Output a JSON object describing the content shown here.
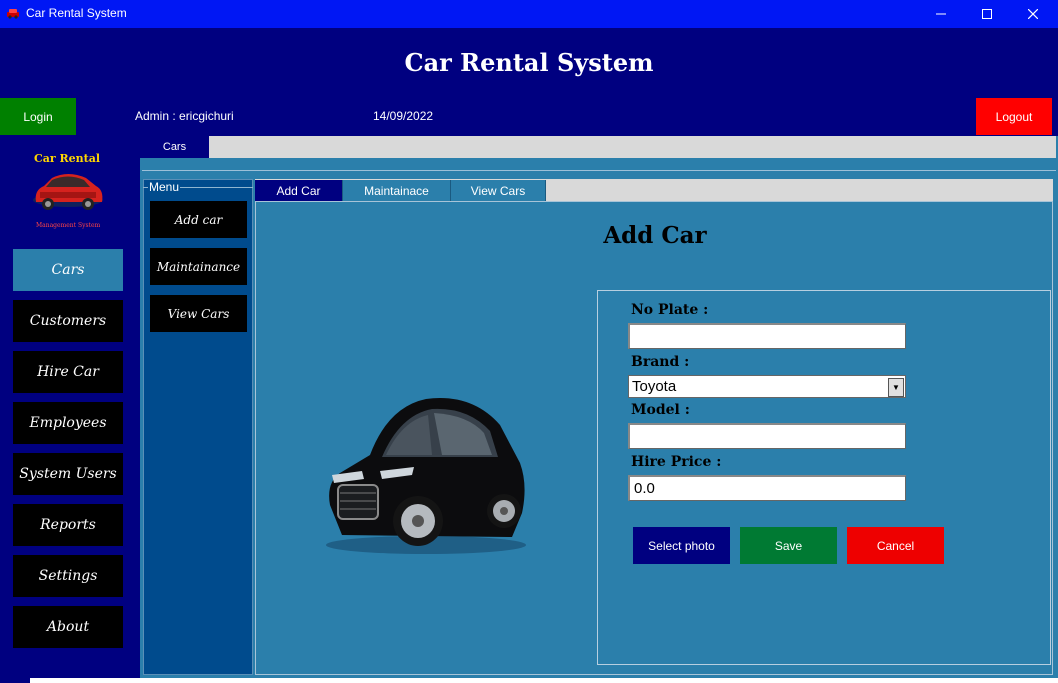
{
  "window": {
    "title": "Car Rental System",
    "icons": {
      "app": "car-app-icon",
      "minimize": "minimize-icon",
      "maximize": "maximize-icon",
      "close": "close-icon"
    }
  },
  "header": {
    "title": "Car Rental System"
  },
  "statusbar": {
    "login_label": "Login",
    "admin_text": "Admin : ericgichuri",
    "date": "14/09/2022",
    "logout_label": "Logout"
  },
  "logo": {
    "line1": "Car Rental",
    "line2": "Management System"
  },
  "sidebar": {
    "items": [
      {
        "label": "Cars",
        "active": true
      },
      {
        "label": "Customers"
      },
      {
        "label": "Hire Car"
      },
      {
        "label": "Employees"
      },
      {
        "label": "System Users"
      },
      {
        "label": "Reports"
      },
      {
        "label": "Settings"
      },
      {
        "label": "About"
      }
    ]
  },
  "top_tabs": [
    {
      "label": "Cars"
    }
  ],
  "menu": {
    "legend": "Menu",
    "items": [
      {
        "label": "Add car"
      },
      {
        "label": "Maintainance"
      },
      {
        "label": "View Cars"
      }
    ]
  },
  "inner_tabs": [
    {
      "label": "Add Car"
    },
    {
      "label": "Maintainace"
    },
    {
      "label": "View Cars"
    }
  ],
  "form": {
    "title": "Add Car",
    "no_plate_label": "No Plate :",
    "no_plate_value": "",
    "brand_label": "Brand :",
    "brand_value": "Toyota",
    "model_label": "Model :",
    "model_value": "",
    "price_label": "Hire Price :",
    "price_value": "0.0",
    "select_photo_label": "Select photo",
    "save_label": "Save",
    "cancel_label": "Cancel"
  },
  "colors": {
    "titlebar": "#0017f4",
    "navy": "#000080",
    "panel": "#2b7fab",
    "login": "#008000",
    "logout": "#ff0000",
    "save": "#007a33",
    "cancel": "#ee0000"
  }
}
